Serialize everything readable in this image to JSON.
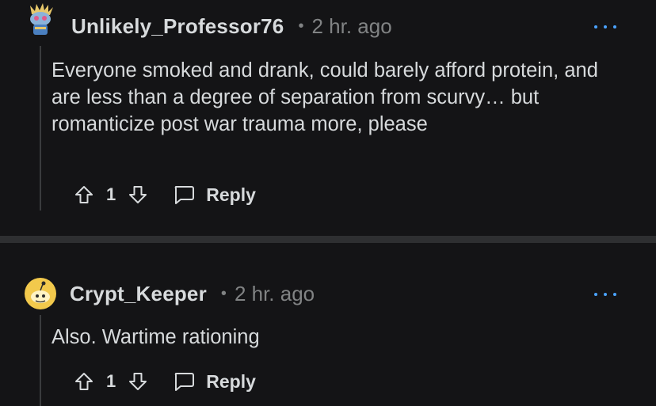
{
  "comments": [
    {
      "username": "Unlikely_Professor76",
      "separator_dot": "•",
      "time": "2 hr. ago",
      "body": "Everyone smoked and drank, could barely afford protein, and are less than a degree of separation from scurvy… but romanticize post war trauma more, please",
      "score": "1",
      "reply_label": "Reply",
      "avatar_icon": "snoo-avatar-icon"
    },
    {
      "username": "Crypt_Keeper",
      "separator_dot": "•",
      "time": "2 hr. ago",
      "body": "Also. Wartime rationing",
      "score": "1",
      "reply_label": "Reply",
      "avatar_icon": "default-snoo-icon"
    }
  ],
  "colors": {
    "background": "#141416",
    "text": "#d7dadc",
    "muted": "#818384",
    "accent": "#4aa3ff",
    "separator": "#2e2f31"
  }
}
